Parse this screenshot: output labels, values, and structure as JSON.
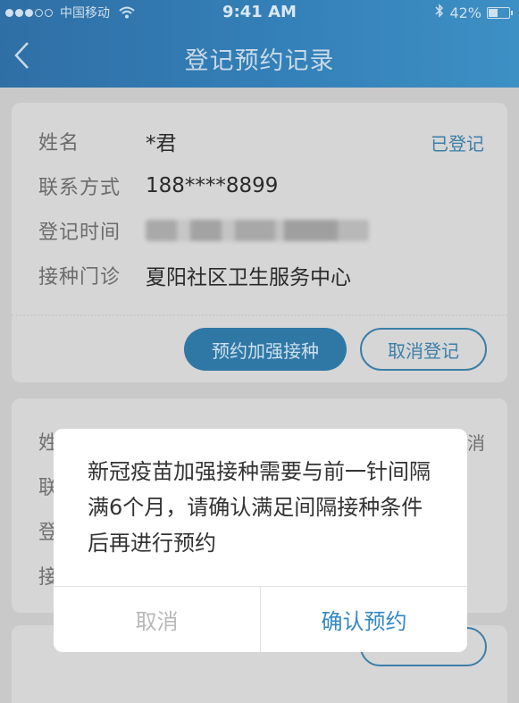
{
  "status_bar": {
    "carrier": "中国移动",
    "time": "9:41 AM",
    "battery": "42%",
    "battery_level": 0.42
  },
  "nav": {
    "title": "登记预约记录"
  },
  "record": {
    "name_label": "姓名",
    "name_value": "*君",
    "status": "已登记",
    "contact_label": "联系方式",
    "contact_value": "188****8899",
    "time_label": "登记时间",
    "clinic_label": "接种门诊",
    "clinic_value": "夏阳社区卫生服务中心",
    "booster_button": "预约加强接种",
    "cancel_button": "取消登记"
  },
  "record2_partial": {
    "name_char": "姓",
    "contact_char": "联",
    "time_char": "登",
    "clinic_char": "接",
    "status_char": "消"
  },
  "dialog": {
    "message": "新冠疫苗加强接种需要与前一针间隔满6个月，请确认满足间隔接种条件后再进行预约",
    "cancel": "取消",
    "confirm": "确认预约"
  },
  "colors": {
    "header": "#3480b8",
    "accent": "#3489c4",
    "overlay": "#c9c9c9"
  }
}
